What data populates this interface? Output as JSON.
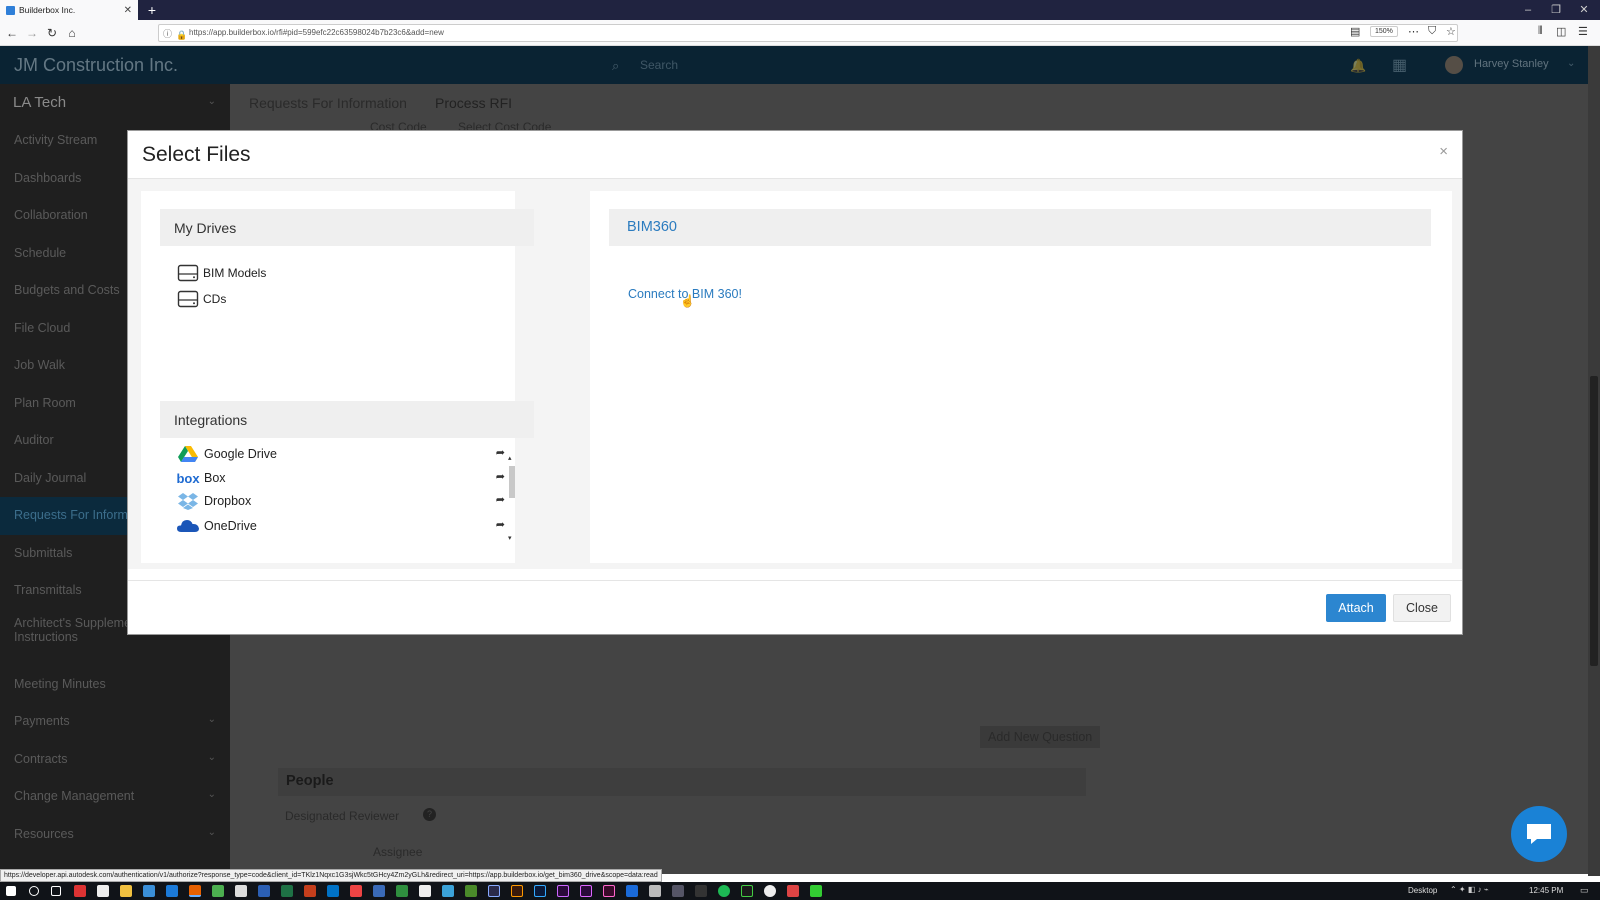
{
  "browser": {
    "tab_title": "Builderbox Inc.",
    "url": "https://app.builderbox.io/rfi#pid=599efc22c63598024b7b23c6&add=new",
    "zoom": "150%",
    "status_url": "https://developer.api.autodesk.com/authentication/v1/authorize?response_type=code&client_id=TKlz1Nqxc1G3sjWkc5tGHcy4Zm2yGLh&redirect_uri=https://app.builderbox.io/get_bim360_drive&scope=data:read"
  },
  "header": {
    "brand": "JM Construction Inc.",
    "search_placeholder": "Search",
    "user_name": "Harvey Stanley"
  },
  "sidebar": {
    "project": "LA Tech",
    "items": [
      {
        "label": "Activity Stream"
      },
      {
        "label": "Dashboards"
      },
      {
        "label": "Collaboration"
      },
      {
        "label": "Schedule"
      },
      {
        "label": "Budgets and Costs"
      },
      {
        "label": "File Cloud"
      },
      {
        "label": "Job Walk"
      },
      {
        "label": "Plan Room"
      },
      {
        "label": "Auditor"
      },
      {
        "label": "Daily Journal"
      },
      {
        "label": "Requests For Inform"
      },
      {
        "label": "Submittals"
      },
      {
        "label": "Transmittals"
      },
      {
        "label": "Architect's Supplemental Instructions"
      },
      {
        "label": "Meeting Minutes"
      },
      {
        "label": "Payments"
      },
      {
        "label": "Contracts"
      },
      {
        "label": "Change Management"
      },
      {
        "label": "Resources"
      }
    ]
  },
  "background": {
    "breadcrumb_1": "Requests For Information",
    "breadcrumb_2": "Process RFI",
    "cost_code_label": "Cost Code",
    "cost_code_value": "Select Cost Code",
    "add_question": "Add New Question",
    "people_heading": "People",
    "designated_reviewer": "Designated Reviewer",
    "assignee": "Assignee"
  },
  "modal": {
    "title": "Select Files",
    "my_drives": {
      "heading": "My Drives",
      "items": [
        {
          "label": "BIM Models"
        },
        {
          "label": "CDs"
        }
      ]
    },
    "integrations": {
      "heading": "Integrations",
      "items": [
        {
          "label": "Google Drive",
          "icon": "google-drive-icon"
        },
        {
          "label": "Box",
          "icon": "box-icon"
        },
        {
          "label": "Dropbox",
          "icon": "dropbox-icon"
        },
        {
          "label": "OneDrive",
          "icon": "onedrive-icon"
        }
      ]
    },
    "bim360": {
      "heading": "BIM360",
      "connect_link": "Connect to BIM 360!"
    },
    "attach_label": "Attach",
    "close_label": "Close"
  },
  "taskbar": {
    "desktop_label": "Desktop",
    "clock": "12:45 PM"
  }
}
